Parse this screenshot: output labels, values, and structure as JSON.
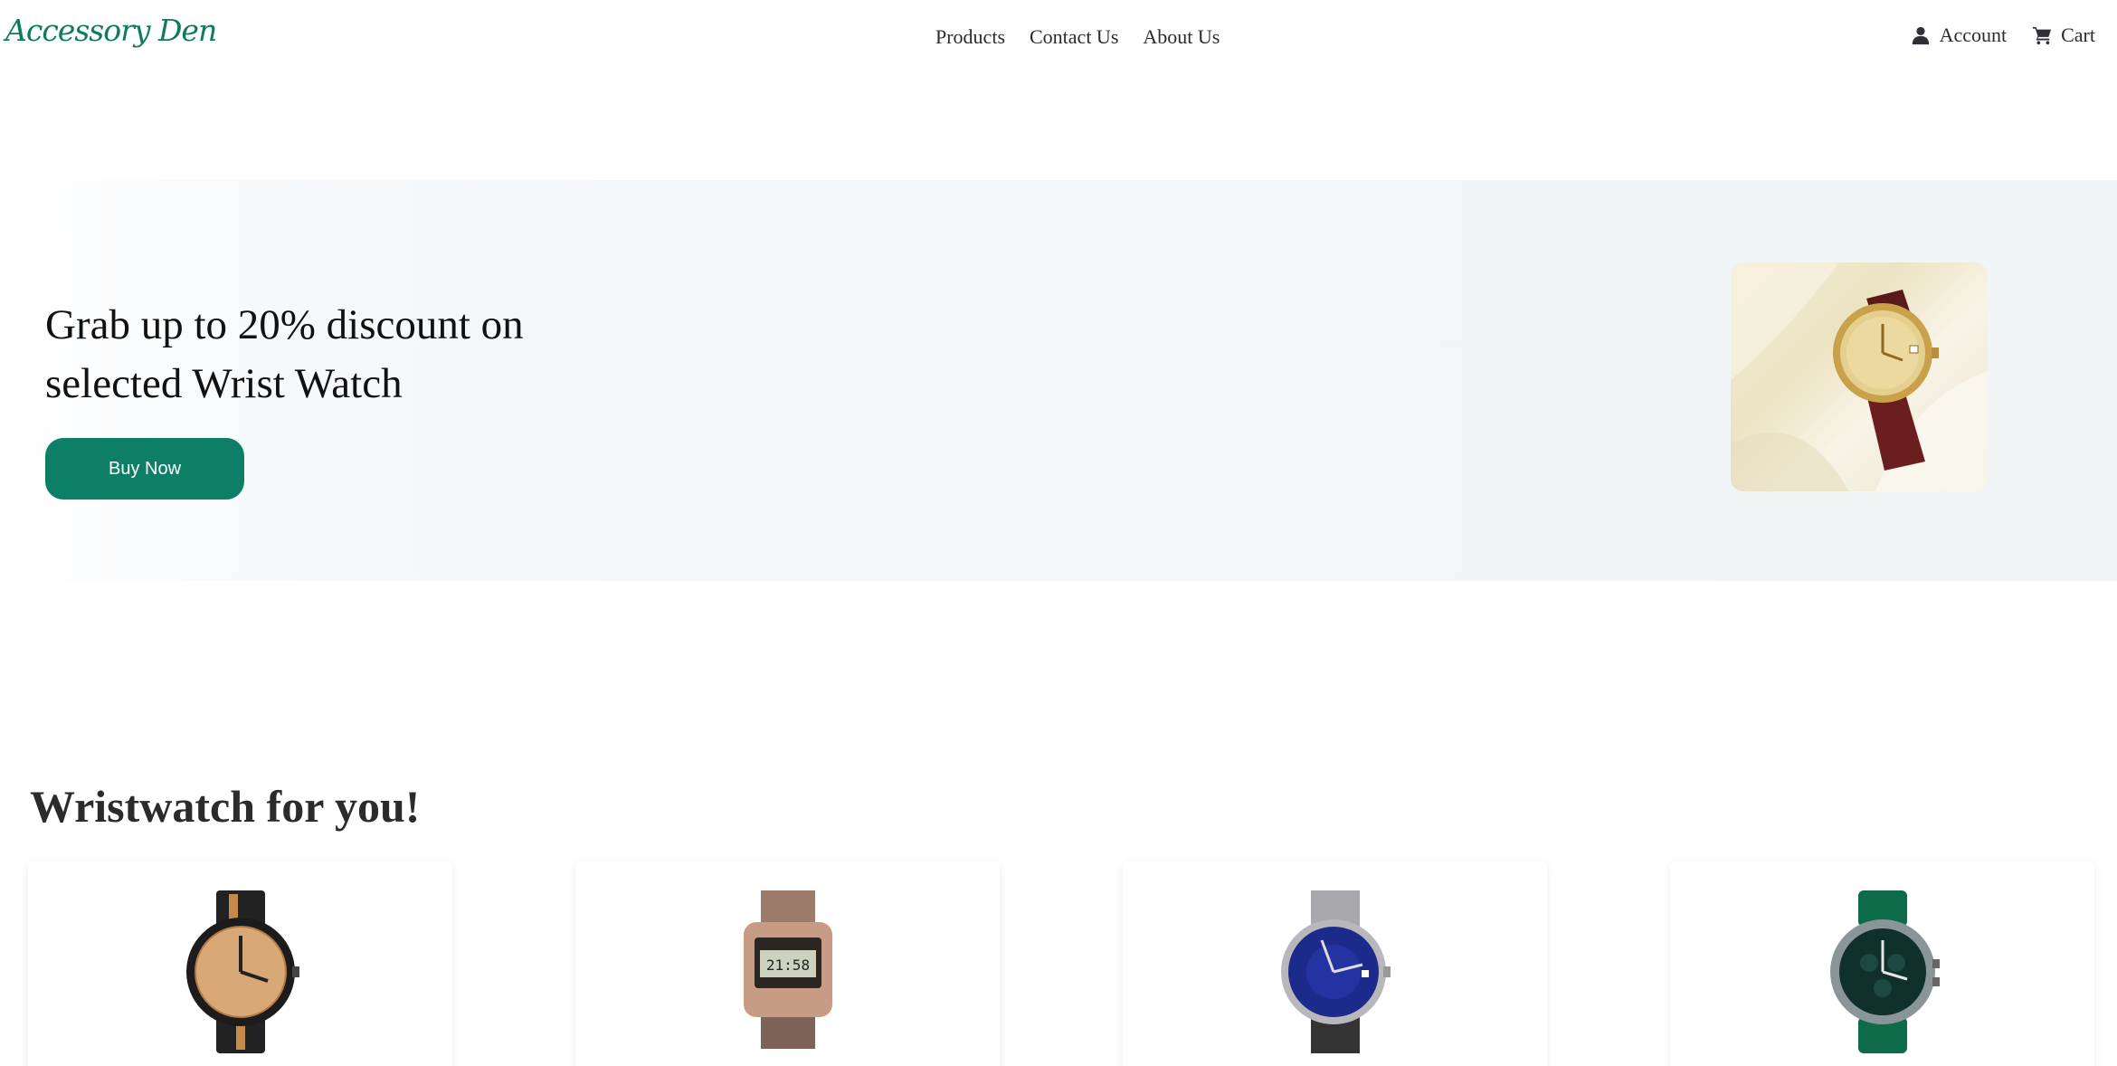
{
  "header": {
    "logo": "Accessory Den",
    "nav": [
      "Products",
      "Contact Us",
      "About Us"
    ],
    "account_label": "Account",
    "cart_label": "Cart"
  },
  "hero": {
    "title_line1": "Grab up to 20% discount on",
    "title_line2": "selected Wrist Watch",
    "button_label": "Buy Now",
    "image_alt": "gold wrist watch on cloth"
  },
  "section": {
    "title": "Wristwatch for you!"
  },
  "products": [
    {
      "image": "wooden-watch"
    },
    {
      "image": "digital-gold-watch"
    },
    {
      "image": "blue-dial-watch"
    },
    {
      "image": "green-chronograph-watch"
    }
  ],
  "colors": {
    "brand": "#0e7a5e",
    "button": "#0d7f66",
    "hero_bg": "#f2f5f8"
  },
  "icons": {
    "account": "user-icon",
    "cart": "cart-icon"
  }
}
